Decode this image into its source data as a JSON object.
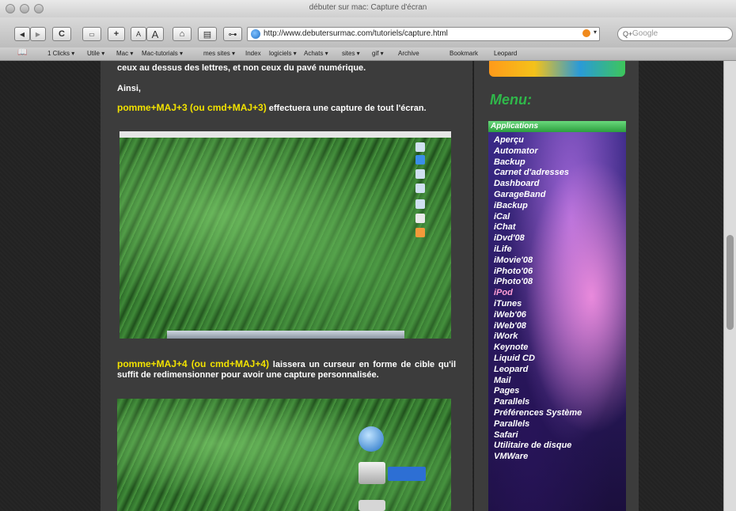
{
  "window": {
    "title": "débuter sur mac: Capture d'écran"
  },
  "toolbar": {
    "back": "◀",
    "forward": "▶",
    "reload": "C",
    "text_small": "A",
    "text_large": "A",
    "url": "http://www.debutersurmac.com/tutoriels/capture.html",
    "search_placeholder": "Google",
    "search_prefix": "Q+"
  },
  "bookmarks": [
    "1 Clicks ▾",
    "Utile ▾",
    "Mac ▾",
    "Mac-tutorials ▾",
    "mes sites ▾",
    "Index",
    "logiciels ▾",
    "Achats ▾",
    "sites ▾",
    "gif ▾",
    "Archive",
    "Bookmark",
    "Leopard"
  ],
  "article": {
    "intro": "ceux au dessus des lettres, et non ceux du pavé numérique.",
    "ainsi": "Ainsi,",
    "shortcut1": "pomme+MAJ+3 (ou cmd+MAJ+3)",
    "desc1": "effectuera une capture de tout l'écran.",
    "shortcut2": "pomme+MAJ+4 (ou cmd+MAJ+4)",
    "desc2": "laissera un curseur en forme de cible qu'il suffit de redimensionner pour avoir une capture personnalisée."
  },
  "sidebar": {
    "menu_title": "Menu:",
    "section_header": "Applications",
    "items": [
      {
        "label": "Aperçu"
      },
      {
        "label": "Automator"
      },
      {
        "label": "Backup"
      },
      {
        "label": "Carnet d'adresses"
      },
      {
        "label": "Dashboard"
      },
      {
        "label": "GarageBand"
      },
      {
        "label": "iBackup"
      },
      {
        "label": "iCal"
      },
      {
        "label": "iChat"
      },
      {
        "label": "iDvd'08"
      },
      {
        "label": "iLife"
      },
      {
        "label": "iMovie'08"
      },
      {
        "label": "iPhoto'06"
      },
      {
        "label": "iPhoto'08"
      },
      {
        "label": "iPod"
      },
      {
        "label": "iTunes"
      },
      {
        "label": "iWeb'06"
      },
      {
        "label": "iWeb'08"
      },
      {
        "label": "iWork"
      },
      {
        "label": "Keynote"
      },
      {
        "label": "Liquid CD"
      },
      {
        "label": "Leopard"
      },
      {
        "label": "Mail"
      },
      {
        "label": "Pages"
      },
      {
        "label": "Parallels"
      },
      {
        "label": "Préférences Système"
      },
      {
        "label": "Parallels"
      },
      {
        "label": "Safari"
      },
      {
        "label": "Utilitaire de disque"
      },
      {
        "label": "VMWare"
      }
    ]
  }
}
